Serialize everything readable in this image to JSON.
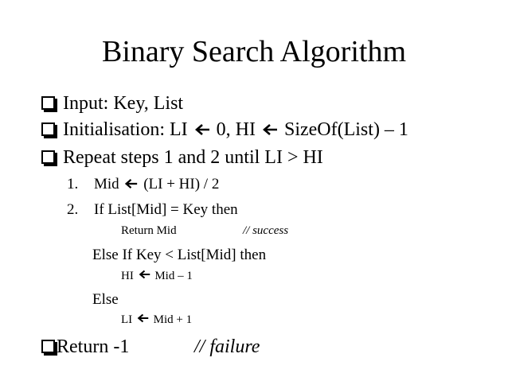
{
  "title": "Binary Search Algorithm",
  "bullets": {
    "input": "Input: Key, List",
    "init_a": "Initialisation: LI",
    "init_b": "0, HI",
    "init_c": "SizeOf(List) – 1",
    "repeat": "Repeat steps 1 and 2 until LI > HI",
    "return": "Return -1",
    "return_comment": "// failure"
  },
  "steps": {
    "s1_num": "1.",
    "s1_a": "Mid",
    "s1_b": "(LI + HI) / 2",
    "s2_num": "2.",
    "s2_text": "If List[Mid] = Key then",
    "return_mid": "Return Mid",
    "success_comment": "// success",
    "elseif": "Else If Key < List[Mid] then",
    "hi_a": "HI",
    "hi_b": "Mid – 1",
    "else": "Else",
    "li_a": "LI",
    "li_b": "Mid + 1"
  },
  "icons": {
    "bullet": "hollow-square-bullet",
    "arrow": "left-arrow"
  }
}
